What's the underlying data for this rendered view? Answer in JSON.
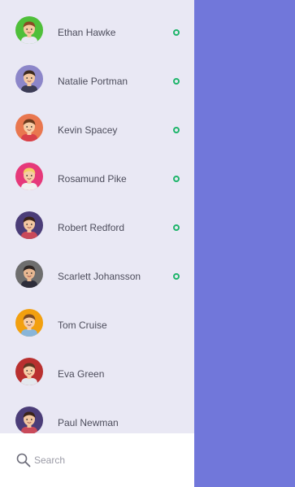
{
  "contacts": [
    {
      "name": "Ethan Hawke",
      "online": true,
      "avatar": {
        "icon": "avatar-boy-green-bg-icon",
        "bg": "#4fbf3a",
        "skin": "#f5c9a0",
        "hair": "#8a4b24",
        "shirt": "#e9e8f4"
      }
    },
    {
      "name": "Natalie Portman",
      "online": true,
      "avatar": {
        "icon": "avatar-man-purple-bg-icon",
        "bg": "#8c86c9",
        "skin": "#f3c7a1",
        "hair": "#3d2a1e",
        "shirt": "#3c3c55"
      }
    },
    {
      "name": "Kevin Spacey",
      "online": true,
      "avatar": {
        "icon": "avatar-woman-orange-bg-icon",
        "bg": "#e9774f",
        "skin": "#f6cda6",
        "hair": "#6b3a1c",
        "shirt": "#d9404a"
      }
    },
    {
      "name": "Rosamund Pike",
      "online": true,
      "avatar": {
        "icon": "avatar-blonde-woman-pink-bg-icon",
        "bg": "#e6397a",
        "skin": "#f6cda6",
        "hair": "#f2cf63",
        "shirt": "#f0f0f0"
      }
    },
    {
      "name": "Robert Redford",
      "online": true,
      "avatar": {
        "icon": "avatar-woman-dark-purple-bg-icon",
        "bg": "#4b3d78",
        "skin": "#f3c7a1",
        "hair": "#3a2318",
        "shirt": "#c94a5a"
      }
    },
    {
      "name": "Scarlett Johansson",
      "online": true,
      "avatar": {
        "icon": "avatar-bearded-man-gray-bg-icon",
        "bg": "#6e6e6e",
        "skin": "#e8b892",
        "hair": "#2e2624",
        "shirt": "#2d2d3a"
      }
    },
    {
      "name": "Tom Cruise",
      "online": false,
      "avatar": {
        "icon": "avatar-man-yellow-bg-icon",
        "bg": "#f2a00f",
        "skin": "#f6cda6",
        "hair": "#7a4a24",
        "shirt": "#88b5d9"
      }
    },
    {
      "name": "Eva Green",
      "online": false,
      "avatar": {
        "icon": "avatar-man-red-bg-icon",
        "bg": "#b9302f",
        "skin": "#f6cda6",
        "hair": "#5b3822",
        "shirt": "#e4e8ee"
      }
    },
    {
      "name": "Paul Newman",
      "online": false,
      "avatar": {
        "icon": "avatar-woman-purple-bg-icon",
        "bg": "#4b3d78",
        "skin": "#f3c7a1",
        "hair": "#3a2318",
        "shirt": "#c94a5a"
      }
    }
  ],
  "search": {
    "placeholder": "Search",
    "icon": "search-icon"
  },
  "colors": {
    "panel": "#e9e8f4",
    "background": "#7177da",
    "online": "#1fb56b"
  }
}
